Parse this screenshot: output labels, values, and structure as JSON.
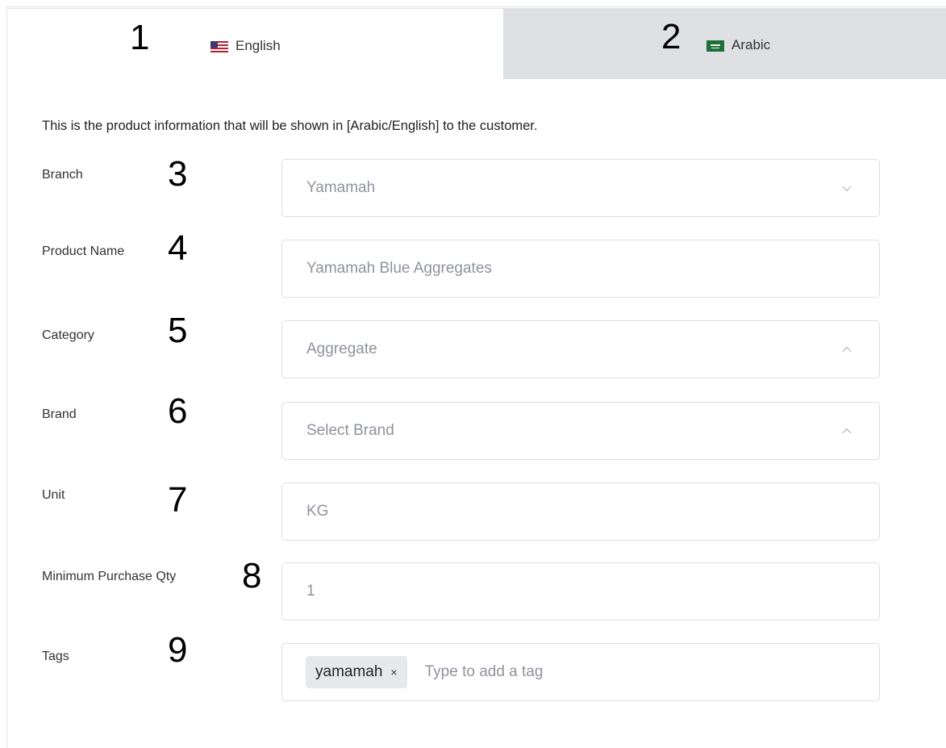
{
  "tabs": [
    {
      "number": "1",
      "label": "English"
    },
    {
      "number": "2",
      "label": "Arabic"
    }
  ],
  "intro_text": "This is the product information that will be shown in [Arabic/English] to the customer.",
  "fields": {
    "branch": {
      "number": "3",
      "label": "Branch",
      "value": "Yamamah"
    },
    "product_name": {
      "number": "4",
      "label": "Product Name",
      "value": "Yamamah Blue Aggregates"
    },
    "category": {
      "number": "5",
      "label": "Category",
      "value": "Aggregate"
    },
    "brand": {
      "number": "6",
      "label": "Brand",
      "value": "Select Brand"
    },
    "unit": {
      "number": "7",
      "label": "Unit",
      "value": "KG"
    },
    "min_qty": {
      "number": "8",
      "label": "Minimum Purchase Qty",
      "value": "1"
    },
    "tags": {
      "number": "9",
      "label": "Tags",
      "tag": "yamamah",
      "tag_close": "×",
      "placeholder": "Type to add a tag"
    }
  },
  "icons": {
    "english_tab_flag": "us-flag-icon",
    "arabic_tab_flag": "saudi-flag-icon",
    "caret_down": "chevron-down-icon",
    "caret_up": "chevron-up-icon"
  },
  "colors": {
    "inactive_tab": "#dfe0e3",
    "field_border": "#dcdfe6",
    "tag_chip": "#e6e8ec"
  }
}
